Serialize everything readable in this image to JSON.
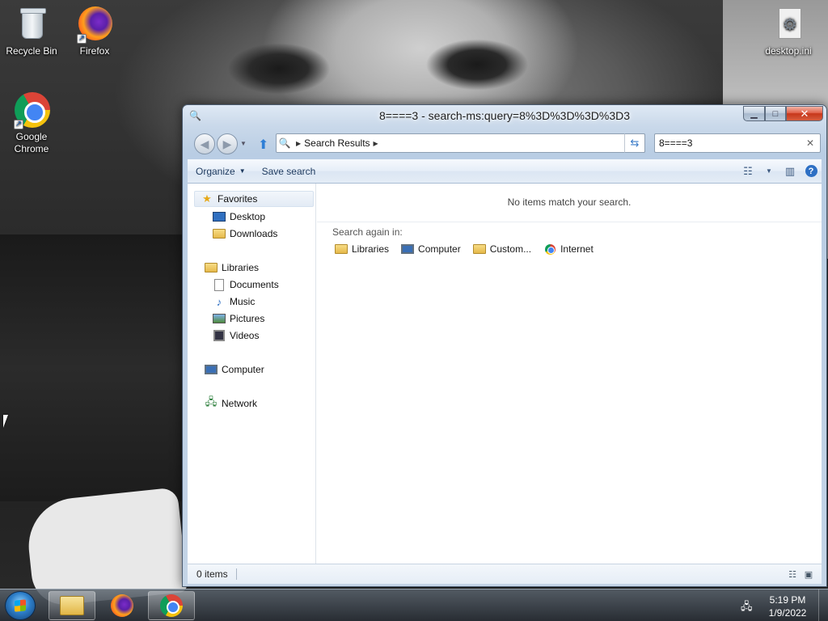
{
  "desktop": {
    "icons": [
      {
        "label": "Recycle Bin",
        "icon": "recycle-bin-icon"
      },
      {
        "label": "Firefox",
        "icon": "firefox-icon"
      },
      {
        "label": "Google Chrome",
        "icon": "chrome-icon"
      },
      {
        "label": "desktop.ini",
        "icon": "settings-file-icon"
      }
    ]
  },
  "window": {
    "title": "8====3 - search-ms:query=8%3D%3D%3D%3D3",
    "address": {
      "breadcrumb": "Search Results"
    },
    "search": {
      "value": "8====3"
    },
    "toolbar": {
      "organize": "Organize",
      "save_search": "Save search"
    },
    "nav": {
      "favorites": "Favorites",
      "desktop": "Desktop",
      "downloads": "Downloads",
      "libraries": "Libraries",
      "documents": "Documents",
      "music": "Music",
      "pictures": "Pictures",
      "videos": "Videos",
      "computer": "Computer",
      "network": "Network"
    },
    "content": {
      "empty_message": "No items match your search.",
      "search_again_label": "Search again in:",
      "search_again_items": [
        "Libraries",
        "Computer",
        "Custom...",
        "Internet"
      ]
    },
    "status": {
      "count": "0 items"
    }
  },
  "taskbar": {
    "apps": [
      "Windows Explorer",
      "Firefox",
      "Google Chrome"
    ],
    "clock": {
      "time": "5:19 PM",
      "date": "1/9/2022"
    }
  },
  "colors": {
    "accent": "#2d6fc4",
    "close_button": "#c7361a",
    "window_frame": "#b9cde4"
  }
}
